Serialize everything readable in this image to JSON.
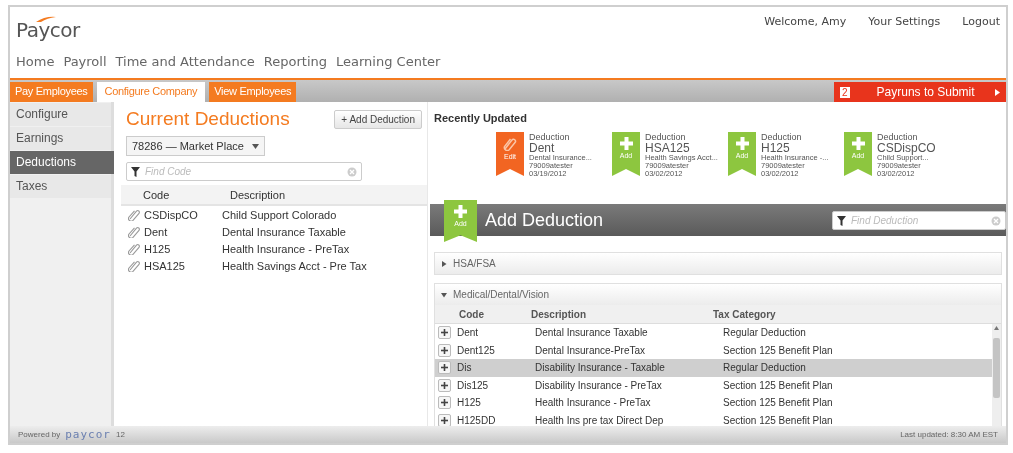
{
  "header": {
    "logo": "Paycor",
    "user_links": [
      "Welcome, Amy",
      "Your Settings",
      "Logout"
    ]
  },
  "nav": [
    "Home",
    "Payroll",
    "Time and Attendance",
    "Reporting",
    "Learning Center"
  ],
  "tabs": [
    {
      "label": "Pay Employees",
      "selected": false
    },
    {
      "label": "Configure Company",
      "selected": true
    },
    {
      "label": "View Employees",
      "selected": false
    }
  ],
  "payruns": {
    "count": "2",
    "label": "Payruns to Submit"
  },
  "sidebar": {
    "items": [
      {
        "label": "Configure",
        "selected": false
      },
      {
        "label": "Earnings",
        "selected": false
      },
      {
        "label": "Deductions",
        "selected": true
      },
      {
        "label": "Taxes",
        "selected": false
      }
    ]
  },
  "current_deductions": {
    "title": "Current Deductions",
    "add_button": "+ Add Deduction",
    "company": "78286 — Market Place",
    "search_placeholder": "Find Code",
    "columns": [
      "Code",
      "Description"
    ],
    "rows": [
      {
        "code": "CSDispCO",
        "description": "Child Support  Colorado"
      },
      {
        "code": "Dent",
        "description": "Dental Insurance Taxable"
      },
      {
        "code": "H125",
        "description": "Health Insurance - PreTax"
      },
      {
        "code": "HSA125",
        "description": "Health Savings Acct - Pre Tax"
      }
    ]
  },
  "recently_updated": {
    "title": "Recently Updated",
    "items": [
      {
        "kind": "edit",
        "badge": "Edit",
        "type": "Deduction",
        "code": "Dent",
        "description": "Dental Insurance...",
        "user": "79009atester",
        "date": "03/19/2012"
      },
      {
        "kind": "add",
        "badge": "Add",
        "type": "Deduction",
        "code": "HSA125",
        "description": "Health Savings Acct...",
        "user": "79009atester",
        "date": "03/02/2012"
      },
      {
        "kind": "add",
        "badge": "Add",
        "type": "Deduction",
        "code": "H125",
        "description": "Health Insurance -...",
        "user": "79009atester",
        "date": "03/02/2012"
      },
      {
        "kind": "add",
        "badge": "Add",
        "type": "Deduction",
        "code": "CSDispCO",
        "description": "Child Support...",
        "user": "79009atester",
        "date": "03/02/2012"
      }
    ]
  },
  "add_deduction": {
    "title": "Add Deduction",
    "badge": "Add",
    "search_placeholder": "Find Deduction",
    "sections": [
      {
        "title": "HSA/FSA",
        "expanded": false
      },
      {
        "title": "Medical/Dental/Vision",
        "expanded": true,
        "columns": [
          "Code",
          "Description",
          "Tax Category"
        ],
        "rows": [
          {
            "code": "Dent",
            "description": "Dental Insurance Taxable",
            "tax_category": "Regular Deduction",
            "selected": false
          },
          {
            "code": "Dent125",
            "description": "Dental Insurance-PreTax",
            "tax_category": "Section 125 Benefit Plan",
            "selected": false
          },
          {
            "code": "Dis",
            "description": "Disability Insurance - Taxable",
            "tax_category": "Regular Deduction",
            "selected": true
          },
          {
            "code": "Dis125",
            "description": "Disability Insurance - PreTax",
            "tax_category": "Section 125 Benefit Plan",
            "selected": false
          },
          {
            "code": "H125",
            "description": "Health Insurance - PreTax",
            "tax_category": "Section 125 Benefit Plan",
            "selected": false
          },
          {
            "code": "H125DD",
            "description": "Health Ins pre tax Direct Dep",
            "tax_category": "Section 125 Benefit Plan",
            "selected": false
          }
        ]
      }
    ]
  },
  "footer": {
    "powered_by": "Powered by",
    "brand": "paycor",
    "version": "12",
    "last_updated": "Last updated: 8:30 AM EST"
  }
}
